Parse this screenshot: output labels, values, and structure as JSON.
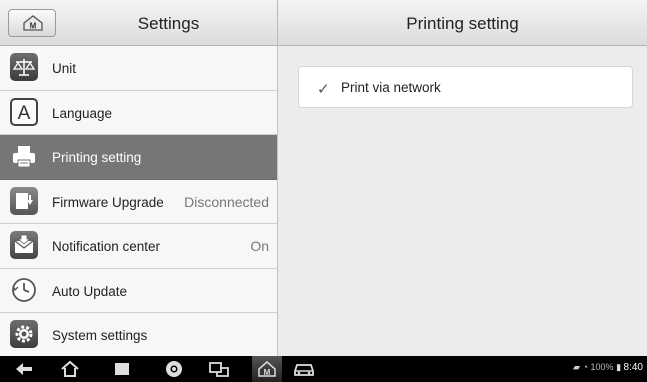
{
  "left_header": {
    "title": "Settings"
  },
  "right_header": {
    "title": "Printing setting"
  },
  "sidebar": {
    "items": [
      {
        "label": "Unit",
        "value": "",
        "icon": "scale-icon"
      },
      {
        "label": "Language",
        "value": "",
        "icon": "language-icon"
      },
      {
        "label": "Printing setting",
        "value": "",
        "icon": "printer-icon",
        "active": true
      },
      {
        "label": "Firmware Upgrade",
        "value": "Disconnected",
        "icon": "firmware-upgrade-icon"
      },
      {
        "label": "Notification center",
        "value": "On",
        "icon": "notification-icon"
      },
      {
        "label": "Auto Update",
        "value": "",
        "icon": "clock-icon"
      },
      {
        "label": "System settings",
        "value": "",
        "icon": "gear-icon"
      }
    ]
  },
  "main": {
    "option": {
      "label": "Print via network",
      "checked": true
    }
  },
  "status_bar": {
    "battery": "100%",
    "time": "8:40"
  },
  "colors": {
    "active_item": "#767676",
    "header_bg": "#e6e6e6",
    "navbar_bg": "#000000"
  }
}
